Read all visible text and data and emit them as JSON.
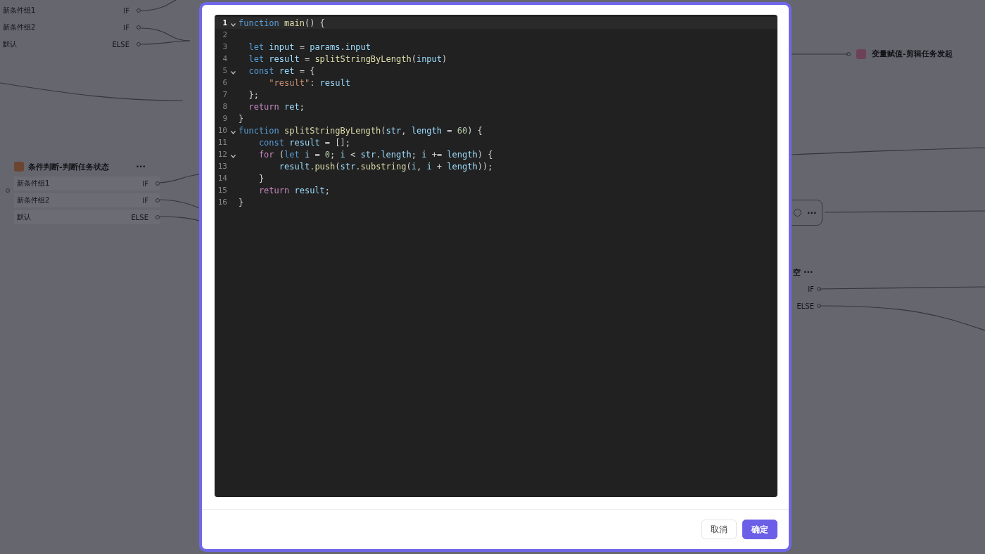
{
  "canvas": {
    "condition_rows_top": [
      {
        "label": "新条件组1",
        "branch": "IF"
      },
      {
        "label": "新条件组2",
        "branch": "IF"
      },
      {
        "label": "默认",
        "branch": "ELSE"
      }
    ],
    "condition_node": {
      "title": "条件判断-判断任务状态",
      "more": "···",
      "rows": [
        {
          "label": "新条件组1",
          "branch": "IF"
        },
        {
          "label": "新条件组2",
          "branch": "IF"
        },
        {
          "label": "默认",
          "branch": "ELSE"
        }
      ]
    },
    "assign_node": {
      "title": "变量赋值-剪辑任务发起"
    },
    "right_node": {
      "more": "···"
    },
    "right_condition": {
      "title_tail": "空",
      "more": "···",
      "rows": [
        {
          "branch": "IF"
        },
        {
          "branch": "ELSE"
        }
      ]
    }
  },
  "dialog": {
    "code_lines": [
      {
        "number": "1",
        "foldable": true,
        "active": true,
        "tokens": [
          {
            "kind": "kw",
            "text": "function"
          },
          {
            "kind": "fn",
            "text": " main"
          },
          {
            "kind": "plain",
            "text": "() {"
          }
        ]
      },
      {
        "number": "2",
        "foldable": false,
        "active": false
      },
      {
        "number": "3",
        "foldable": false,
        "active": false,
        "tokens": [
          {
            "kind": "kw",
            "text": "  let"
          },
          {
            "kind": "var",
            "text": " input"
          },
          {
            "kind": "plain",
            "text": " = "
          },
          {
            "kind": "var",
            "text": "params"
          },
          {
            "kind": "plain",
            "text": "."
          },
          {
            "kind": "var",
            "text": "input"
          }
        ]
      },
      {
        "number": "4",
        "foldable": false,
        "active": false,
        "tokens": [
          {
            "kind": "kw",
            "text": "  let"
          },
          {
            "kind": "var",
            "text": " result"
          },
          {
            "kind": "plain",
            "text": " = "
          },
          {
            "kind": "fn",
            "text": "splitStringByLength"
          },
          {
            "kind": "plain",
            "text": "("
          },
          {
            "kind": "var",
            "text": "input"
          },
          {
            "kind": "plain",
            "text": ")"
          }
        ]
      },
      {
        "number": "5",
        "foldable": true,
        "active": false,
        "tokens": [
          {
            "kind": "kw",
            "text": "  const"
          },
          {
            "kind": "var",
            "text": " ret"
          },
          {
            "kind": "plain",
            "text": " = {"
          }
        ]
      },
      {
        "number": "6",
        "foldable": false,
        "active": false,
        "tokens": [
          {
            "kind": "str",
            "text": "      \"result\""
          },
          {
            "kind": "plain",
            "text": ": "
          },
          {
            "kind": "var",
            "text": "result"
          }
        ]
      },
      {
        "number": "7",
        "foldable": false,
        "active": false,
        "tokens": [
          {
            "kind": "plain",
            "text": "  };"
          }
        ]
      },
      {
        "number": "8",
        "foldable": false,
        "active": false,
        "tokens": [
          {
            "kind": "ctl",
            "text": "  return"
          },
          {
            "kind": "var",
            "text": " ret"
          },
          {
            "kind": "plain",
            "text": ";"
          }
        ]
      },
      {
        "number": "9",
        "foldable": false,
        "active": false,
        "tokens": [
          {
            "kind": "plain",
            "text": "}"
          }
        ]
      },
      {
        "number": "10",
        "foldable": true,
        "active": false,
        "tokens": [
          {
            "kind": "kw",
            "text": "function"
          },
          {
            "kind": "fn",
            "text": " splitStringByLength"
          },
          {
            "kind": "plain",
            "text": "("
          },
          {
            "kind": "var",
            "text": "str"
          },
          {
            "kind": "plain",
            "text": ", "
          },
          {
            "kind": "var",
            "text": "length"
          },
          {
            "kind": "plain",
            "text": " = "
          },
          {
            "kind": "num",
            "text": "60"
          },
          {
            "kind": "plain",
            "text": ") {"
          }
        ]
      },
      {
        "number": "11",
        "foldable": false,
        "active": false,
        "tokens": [
          {
            "kind": "kw",
            "text": "    const"
          },
          {
            "kind": "var",
            "text": " result"
          },
          {
            "kind": "plain",
            "text": " = [];"
          }
        ]
      },
      {
        "number": "12",
        "foldable": true,
        "active": false,
        "tokens": [
          {
            "kind": "ctl",
            "text": "    for"
          },
          {
            "kind": "plain",
            "text": " ("
          },
          {
            "kind": "kw",
            "text": "let"
          },
          {
            "kind": "var",
            "text": " i"
          },
          {
            "kind": "plain",
            "text": " = "
          },
          {
            "kind": "num",
            "text": "0"
          },
          {
            "kind": "plain",
            "text": "; "
          },
          {
            "kind": "var",
            "text": "i"
          },
          {
            "kind": "plain",
            "text": " < "
          },
          {
            "kind": "var",
            "text": "str"
          },
          {
            "kind": "plain",
            "text": "."
          },
          {
            "kind": "var",
            "text": "length"
          },
          {
            "kind": "plain",
            "text": "; "
          },
          {
            "kind": "var",
            "text": "i"
          },
          {
            "kind": "plain",
            "text": " += "
          },
          {
            "kind": "var",
            "text": "length"
          },
          {
            "kind": "plain",
            "text": ") {"
          }
        ]
      },
      {
        "number": "13",
        "foldable": false,
        "active": false,
        "tokens": [
          {
            "kind": "var",
            "text": "        result"
          },
          {
            "kind": "plain",
            "text": "."
          },
          {
            "kind": "fn",
            "text": "push"
          },
          {
            "kind": "plain",
            "text": "("
          },
          {
            "kind": "var",
            "text": "str"
          },
          {
            "kind": "plain",
            "text": "."
          },
          {
            "kind": "fn",
            "text": "substring"
          },
          {
            "kind": "plain",
            "text": "("
          },
          {
            "kind": "var",
            "text": "i"
          },
          {
            "kind": "plain",
            "text": ", "
          },
          {
            "kind": "var",
            "text": "i"
          },
          {
            "kind": "plain",
            "text": " + "
          },
          {
            "kind": "var",
            "text": "length"
          },
          {
            "kind": "plain",
            "text": "));"
          }
        ]
      },
      {
        "number": "14",
        "foldable": false,
        "active": false,
        "tokens": [
          {
            "kind": "plain",
            "text": "    }"
          }
        ]
      },
      {
        "number": "15",
        "foldable": false,
        "active": false,
        "tokens": [
          {
            "kind": "ctl",
            "text": "    return"
          },
          {
            "kind": "var",
            "text": " result"
          },
          {
            "kind": "plain",
            "text": ";"
          }
        ]
      },
      {
        "number": "16",
        "foldable": false,
        "active": false,
        "tokens": [
          {
            "kind": "plain",
            "text": "}"
          }
        ]
      }
    ],
    "buttons": [
      {
        "label": "取消",
        "kind": "secondary"
      },
      {
        "label": "确定",
        "kind": "primary"
      }
    ]
  }
}
